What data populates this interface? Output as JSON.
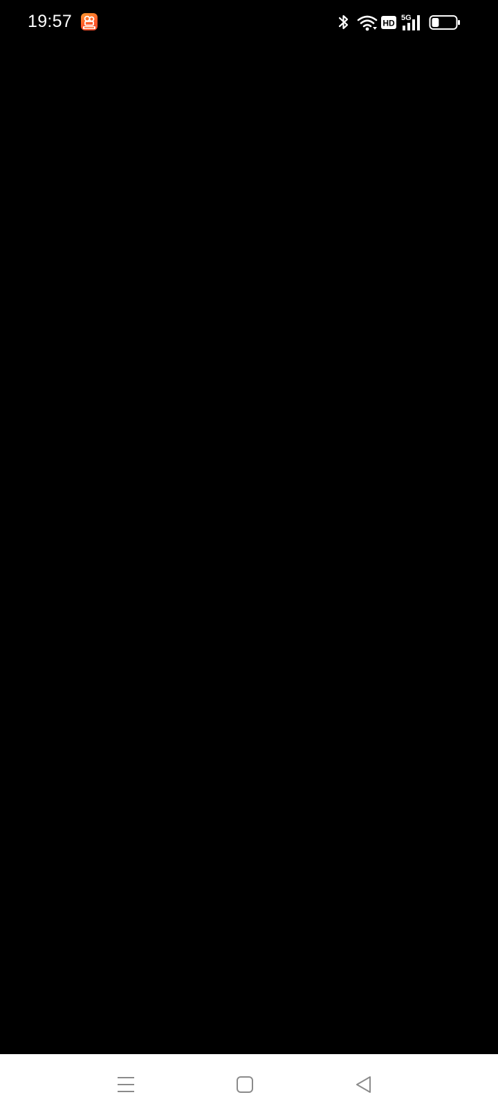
{
  "status_bar": {
    "time": "19:57",
    "notification_app_icon": "video-app-icon",
    "network_label": "5G",
    "hd_label": "HD",
    "battery_level": 0.3
  },
  "content": {
    "state": "blank"
  },
  "navigation_bar": {
    "buttons": [
      {
        "icon": "menu-icon",
        "action": "recent-apps"
      },
      {
        "icon": "home-square-icon",
        "action": "home"
      },
      {
        "icon": "back-triangle-icon",
        "action": "back"
      }
    ]
  },
  "colors": {
    "background": "#000000",
    "status_text": "#ffffff",
    "nav_bar_bg": "#ffffff",
    "nav_icon": "#8a8a8a",
    "app_badge_orange": "#ff7a2c"
  }
}
